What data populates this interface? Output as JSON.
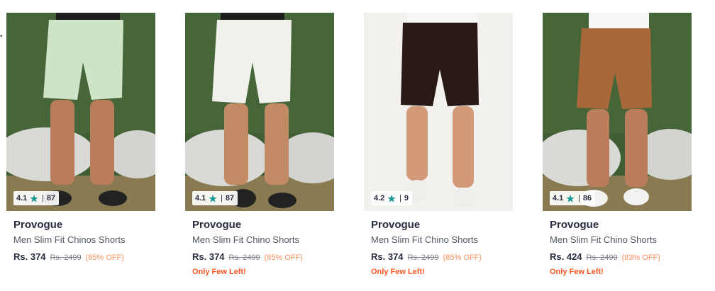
{
  "colors": {
    "rating_star": "#14958f",
    "discount": "#ff905a",
    "low_stock": "#ff5722"
  },
  "products": [
    {
      "brand": "Provogue",
      "title": "Men Slim Fit Chinos Shorts",
      "price": "Rs. 374",
      "mrp": "Rs. 2499",
      "discount": "(85% OFF)",
      "rating": "4.1",
      "rating_count": "87",
      "stock_note": "",
      "shorts_color": "#cfe3c6",
      "image_icon": "product-photo"
    },
    {
      "brand": "Provogue",
      "title": "Men Slim Fit Chino Shorts",
      "price": "Rs. 374",
      "mrp": "Rs. 2499",
      "discount": "(85% OFF)",
      "rating": "4.1",
      "rating_count": "87",
      "stock_note": "Only Few Left!",
      "shorts_color": "#f1f1ec",
      "image_icon": "product-photo"
    },
    {
      "brand": "Provogue",
      "title": "Men Slim Fit Chino Shorts",
      "price": "Rs. 374",
      "mrp": "Rs. 2499",
      "discount": "(85% OFF)",
      "rating": "4.2",
      "rating_count": "9",
      "stock_note": "Only Few Left!",
      "shorts_color": "#2a1a16",
      "image_icon": "product-photo"
    },
    {
      "brand": "Provogue",
      "title": "Men Slim Fit Chino Shorts",
      "price": "Rs. 424",
      "mrp": "Rs. 2499",
      "discount": "(83% OFF)",
      "rating": "4.1",
      "rating_count": "86",
      "stock_note": "Only Few Left!",
      "shorts_color": "#a8683a",
      "image_icon": "product-photo"
    }
  ]
}
